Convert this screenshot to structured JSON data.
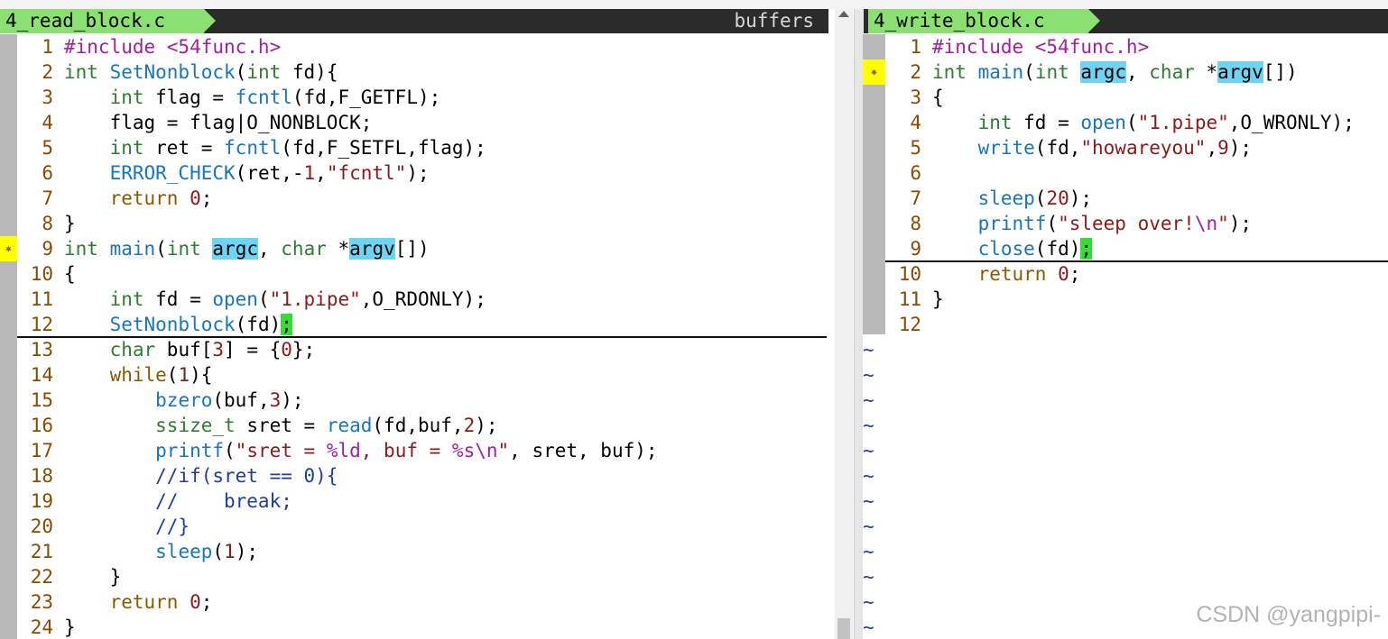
{
  "left": {
    "tab_label": "4_read_block.c",
    "buffers_label": "buffers",
    "lines": [
      [
        [
          "pre",
          "#include <54func.h>"
        ]
      ],
      [
        [
          "type",
          "int "
        ],
        [
          "fn",
          "SetNonblock"
        ],
        [
          "plain",
          "("
        ],
        [
          "type",
          "int"
        ],
        [
          "plain",
          " fd){"
        ]
      ],
      [
        [
          "plain",
          "    "
        ],
        [
          "type",
          "int"
        ],
        [
          "plain",
          " flag = "
        ],
        [
          "fn",
          "fcntl"
        ],
        [
          "plain",
          "(fd,F_GETFL);"
        ]
      ],
      [
        [
          "plain",
          "    flag = flag|O_NONBLOCK;"
        ]
      ],
      [
        [
          "plain",
          "    "
        ],
        [
          "type",
          "int"
        ],
        [
          "plain",
          " ret = "
        ],
        [
          "fn",
          "fcntl"
        ],
        [
          "plain",
          "(fd,F_SETFL,flag);"
        ]
      ],
      [
        [
          "plain",
          "    "
        ],
        [
          "fn",
          "ERROR_CHECK"
        ],
        [
          "plain",
          "(ret,-"
        ],
        [
          "num",
          "1"
        ],
        [
          "plain",
          ","
        ],
        [
          "str",
          "\"fcntl\""
        ],
        [
          "plain",
          ");"
        ]
      ],
      [
        [
          "plain",
          "    "
        ],
        [
          "kw",
          "return"
        ],
        [
          "plain",
          " "
        ],
        [
          "num",
          "0"
        ],
        [
          "plain",
          ";"
        ]
      ],
      [
        [
          "plain",
          "}"
        ]
      ],
      [
        [
          "type",
          "int "
        ],
        [
          "fn",
          "main"
        ],
        [
          "plain",
          "("
        ],
        [
          "type",
          "int"
        ],
        [
          "plain",
          " "
        ],
        [
          "search",
          "argc"
        ],
        [
          "plain",
          ", "
        ],
        [
          "type",
          "char"
        ],
        [
          "plain",
          " *"
        ],
        [
          "search",
          "argv"
        ],
        [
          "plain",
          "[])"
        ]
      ],
      [
        [
          "plain",
          "{"
        ]
      ],
      [
        [
          "plain",
          "    "
        ],
        [
          "type",
          "int"
        ],
        [
          "plain",
          " fd = "
        ],
        [
          "fn",
          "open"
        ],
        [
          "plain",
          "("
        ],
        [
          "str",
          "\"1.pipe\""
        ],
        [
          "plain",
          ",O_RDONLY);"
        ]
      ],
      [
        [
          "plain",
          "    "
        ],
        [
          "fn",
          "SetNonblock"
        ],
        [
          "plain",
          "(fd)"
        ],
        [
          "cursor",
          ";"
        ]
      ],
      [
        [
          "plain",
          "    "
        ],
        [
          "type",
          "char"
        ],
        [
          "plain",
          " buf["
        ],
        [
          "num",
          "3"
        ],
        [
          "plain",
          "] = {"
        ],
        [
          "num",
          "0"
        ],
        [
          "plain",
          "};"
        ]
      ],
      [
        [
          "plain",
          "    "
        ],
        [
          "kw",
          "while"
        ],
        [
          "plain",
          "("
        ],
        [
          "num",
          "1"
        ],
        [
          "plain",
          "){"
        ]
      ],
      [
        [
          "plain",
          "        "
        ],
        [
          "fn",
          "bzero"
        ],
        [
          "plain",
          "(buf,"
        ],
        [
          "num",
          "3"
        ],
        [
          "plain",
          ");"
        ]
      ],
      [
        [
          "plain",
          "        "
        ],
        [
          "type",
          "ssize_t"
        ],
        [
          "plain",
          " sret = "
        ],
        [
          "fn",
          "read"
        ],
        [
          "plain",
          "(fd,buf,"
        ],
        [
          "num",
          "2"
        ],
        [
          "plain",
          ");"
        ]
      ],
      [
        [
          "plain",
          "        "
        ],
        [
          "fn",
          "printf"
        ],
        [
          "plain",
          "("
        ],
        [
          "str",
          "\"sret = "
        ],
        [
          "esc",
          "%ld"
        ],
        [
          "str",
          ", buf = "
        ],
        [
          "esc",
          "%s\\n"
        ],
        [
          "str",
          "\""
        ],
        [
          "plain",
          ", sret, buf);"
        ]
      ],
      [
        [
          "com",
          "        //if(sret == 0){"
        ]
      ],
      [
        [
          "com",
          "        //    break;"
        ]
      ],
      [
        [
          "com",
          "        //}"
        ]
      ],
      [
        [
          "plain",
          "        "
        ],
        [
          "fn",
          "sleep"
        ],
        [
          "plain",
          "("
        ],
        [
          "num",
          "1"
        ],
        [
          "plain",
          ");"
        ]
      ],
      [
        [
          "plain",
          "    }"
        ]
      ],
      [
        [
          "plain",
          "    "
        ],
        [
          "kw",
          "return"
        ],
        [
          "plain",
          " "
        ],
        [
          "num",
          "0"
        ],
        [
          "plain",
          ";"
        ]
      ],
      [
        [
          "plain",
          "}"
        ]
      ]
    ]
  },
  "right": {
    "tab_label": "4_write_block.c",
    "tilde": "~",
    "lines": [
      [
        [
          "pre",
          "#include <54func.h>"
        ]
      ],
      [
        [
          "type",
          "int "
        ],
        [
          "fn",
          "main"
        ],
        [
          "plain",
          "("
        ],
        [
          "type",
          "int"
        ],
        [
          "plain",
          " "
        ],
        [
          "search",
          "argc"
        ],
        [
          "plain",
          ", "
        ],
        [
          "type",
          "char"
        ],
        [
          "plain",
          " *"
        ],
        [
          "search",
          "argv"
        ],
        [
          "plain",
          "[])"
        ]
      ],
      [
        [
          "plain",
          "{"
        ]
      ],
      [
        [
          "plain",
          "    "
        ],
        [
          "type",
          "int"
        ],
        [
          "plain",
          " fd = "
        ],
        [
          "fn",
          "open"
        ],
        [
          "plain",
          "("
        ],
        [
          "str",
          "\"1.pipe\""
        ],
        [
          "plain",
          ",O_WRONLY);"
        ]
      ],
      [
        [
          "plain",
          "    "
        ],
        [
          "fn",
          "write"
        ],
        [
          "plain",
          "(fd,"
        ],
        [
          "str",
          "\"howareyou\""
        ],
        [
          "plain",
          ","
        ],
        [
          "num",
          "9"
        ],
        [
          "plain",
          ");"
        ]
      ],
      [
        [
          "plain",
          ""
        ]
      ],
      [
        [
          "plain",
          "    "
        ],
        [
          "fn",
          "sleep"
        ],
        [
          "plain",
          "("
        ],
        [
          "num",
          "20"
        ],
        [
          "plain",
          ");"
        ]
      ],
      [
        [
          "plain",
          "    "
        ],
        [
          "fn",
          "printf"
        ],
        [
          "plain",
          "("
        ],
        [
          "str",
          "\"sleep over!"
        ],
        [
          "esc",
          "\\n"
        ],
        [
          "str",
          "\""
        ],
        [
          "plain",
          ");"
        ]
      ],
      [
        [
          "plain",
          "    "
        ],
        [
          "fn",
          "close"
        ],
        [
          "plain",
          "(fd)"
        ],
        [
          "cursor",
          ";"
        ]
      ],
      [
        [
          "plain",
          "    "
        ],
        [
          "kw",
          "return"
        ],
        [
          "plain",
          " "
        ],
        [
          "num",
          "0"
        ],
        [
          "plain",
          ";"
        ]
      ],
      [
        [
          "plain",
          "}"
        ]
      ],
      [
        [
          "plain",
          ""
        ]
      ]
    ]
  },
  "sign_marker_glyph": "✷",
  "watermark": "CSDN @yangpipi-",
  "colors": {
    "tab_bg": "#8ae070",
    "search_highlight": "#6fd3f2",
    "cursor": "#33dd33",
    "sign_marker": "#ffff00"
  }
}
